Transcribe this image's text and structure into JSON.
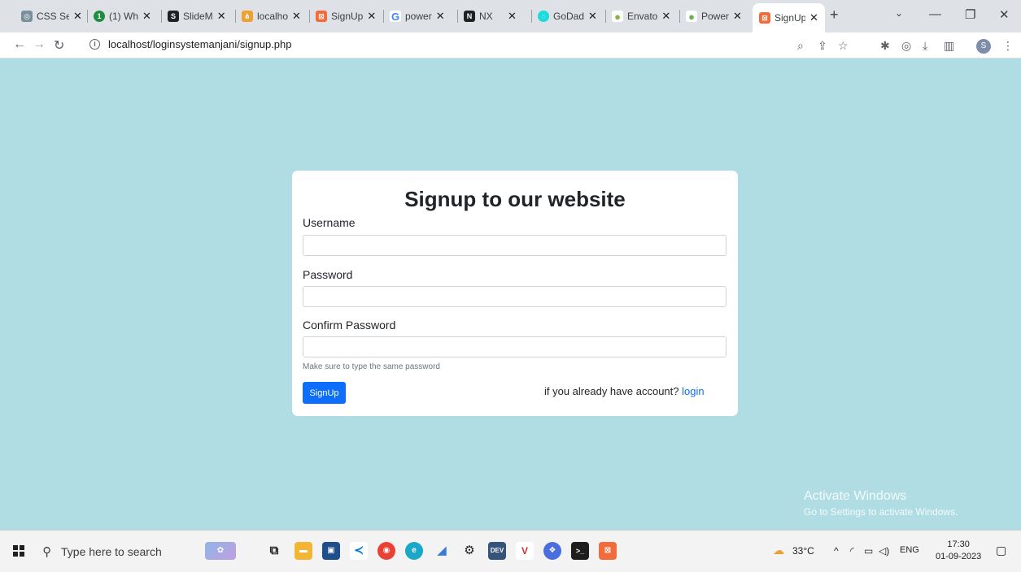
{
  "tabs": [
    {
      "label": "CSS Se",
      "fav_color": "#7a8f9c",
      "fav_glyph": "◎"
    },
    {
      "label": "(1) Wh",
      "fav_color": "#1e8e3e",
      "fav_glyph": "1"
    },
    {
      "label": "SlideM",
      "fav_color": "#202124",
      "fav_glyph": "S"
    },
    {
      "label": "localho",
      "fav_color": "#f0a030",
      "fav_glyph": "⋔"
    },
    {
      "label": "SignUp",
      "fav_color": "#f26b3a",
      "fav_glyph": "⊠"
    },
    {
      "label": "power",
      "fav_color": "#4285f4",
      "fav_glyph": "G"
    },
    {
      "label": "NX",
      "fav_color": "#202124",
      "fav_glyph": "N"
    },
    {
      "label": "GoDad",
      "fav_color": "#1bdbdb",
      "fav_glyph": "◌"
    },
    {
      "label": "Envato",
      "fav_color": "#82b541",
      "fav_glyph": "●"
    },
    {
      "label": "Power",
      "fav_color": "#6ab04c",
      "fav_glyph": "●"
    },
    {
      "label": "SignUp",
      "fav_color": "#f26b3a",
      "fav_glyph": "⊠"
    }
  ],
  "browser": {
    "url": "localhost/loginsystemanjani/signup.php",
    "profile_initial": "S"
  },
  "form": {
    "title": "Signup to our website",
    "username_label": "Username",
    "password_label": "Password",
    "confirm_label": "Confirm Password",
    "help_text": "Make sure to type the same password",
    "submit_label": "SignUp",
    "already_text": "if you already have account?",
    "login_link": "login"
  },
  "watermark": {
    "line1": "Activate Windows",
    "line2": "Go to Settings to activate Windows."
  },
  "taskbar": {
    "search_placeholder": "Type here to search",
    "weather": "33°C",
    "language": "ENG",
    "time": "17:30",
    "date": "01-09-2023"
  },
  "colors": {
    "page_bg": "#b0dde3",
    "primary": "#0d6efd"
  }
}
